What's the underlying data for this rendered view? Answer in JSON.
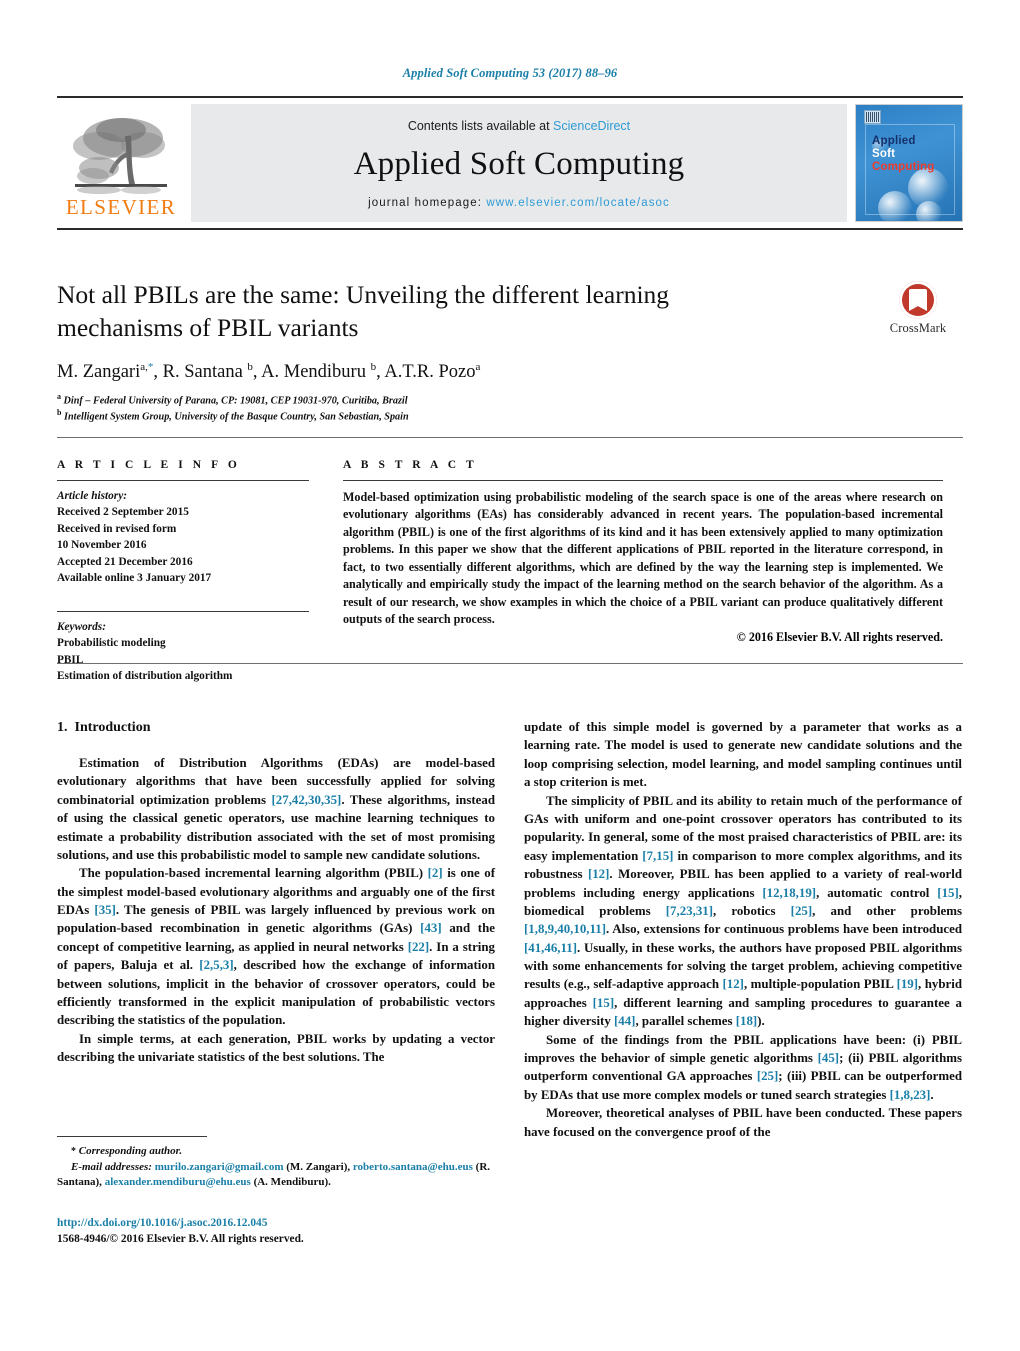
{
  "running_head": "Applied Soft Computing 53 (2017) 88–96",
  "masthead": {
    "publisher_name": "ELSEVIER",
    "contents_prefix": "Contents lists available at ",
    "contents_link": "ScienceDirect",
    "journal_title": "Applied Soft Computing",
    "homepage_prefix": "journal homepage: ",
    "homepage_url": "www.elsevier.com/locate/asoc",
    "cover": {
      "line1": "Applied",
      "line2": "Soft",
      "line3": "Computing",
      "color_applied": "#16306b",
      "color_soft": "#ffffff",
      "color_computing": "#ef3b2c",
      "background": "#2c7fc4"
    }
  },
  "article": {
    "title": "Not all PBILs are the same: Unveiling the different learning mechanisms of PBIL variants",
    "crossmark_label": "CrossMark",
    "authors": [
      {
        "name": "M. Zangari",
        "sup": "a,",
        "star": "*"
      },
      {
        "name": "R. Santana",
        "sup": "b"
      },
      {
        "name": "A. Mendiburu",
        "sup": "b"
      },
      {
        "name": "A.T.R. Pozo",
        "sup": "a"
      }
    ],
    "affiliations": [
      {
        "mark": "a",
        "text": "Dinf – Federal University of Parana, CP: 19081, CEP 19031-970, Curitiba, Brazil"
      },
      {
        "mark": "b",
        "text": "Intelligent System Group, University of the Basque Country, San Sebastian, Spain"
      }
    ]
  },
  "article_info": {
    "heading": "A R T I C L E  I N F O",
    "history_label": "Article history:",
    "history": [
      "Received 2 September 2015",
      "Received in revised form",
      "10 November 2016",
      "Accepted 21 December 2016",
      "Available online 3 January 2017"
    ],
    "keywords_label": "Keywords:",
    "keywords": [
      "Probabilistic modeling",
      "PBIL",
      "Estimation of distribution algorithm"
    ]
  },
  "abstract": {
    "heading": "A B S T R A C T",
    "text": "Model-based optimization using probabilistic modeling of the search space is one of the areas where research on evolutionary algorithms (EAs) has considerably advanced in recent years. The population-based incremental algorithm (PBIL) is one of the first algorithms of its kind and it has been extensively applied to many optimization problems. In this paper we show that the different applications of PBIL reported in the literature correspond, in fact, to two essentially different algorithms, which are defined by the way the learning step is implemented. We analytically and empirically study the impact of the learning method on the search behavior of the algorithm. As a result of our research, we show examples in which the choice of a PBIL variant can produce qualitatively different outputs of the search process.",
    "copyright": "© 2016 Elsevier B.V. All rights reserved."
  },
  "body": {
    "section_number": "1.",
    "section_title": "Introduction",
    "left_paragraphs": [
      "Estimation of Distribution Algorithms (EDAs) are model-based evolutionary algorithms that have been successfully applied for solving combinatorial optimization problems [27,42,30,35]. These algorithms, instead of using the classical genetic operators, use machine learning techniques to estimate a probability distribution associated with the set of most promising solutions, and use this probabilistic model to sample new candidate solutions.",
      "The population-based incremental learning algorithm (PBIL) [2] is one of the simplest model-based evolutionary algorithms and arguably one of the first EDAs [35]. The genesis of PBIL was largely influenced by previous work on population-based recombination in genetic algorithms (GAs) [43] and the concept of competitive learning, as applied in neural networks [22]. In a string of papers, Baluja et al. [2,5,3], described how the exchange of information between solutions, implicit in the behavior of crossover operators, could be efficiently transformed in the explicit manipulation of probabilistic vectors describing the statistics of the population.",
      "In simple terms, at each generation, PBIL works by updating a vector describing the univariate statistics of the best solutions. The"
    ],
    "right_paragraphs": [
      "update of this simple model is governed by a parameter that works as a learning rate. The model is used to generate new candidate solutions and the loop comprising selection, model learning, and model sampling continues until a stop criterion is met.",
      "The simplicity of PBIL and its ability to retain much of the performance of GAs with uniform and one-point crossover operators has contributed to its popularity. In general, some of the most praised characteristics of PBIL are: its easy implementation [7,15] in comparison to more complex algorithms, and its robustness [12]. Moreover, PBIL has been applied to a variety of real-world problems including energy applications [12,18,19], automatic control [15], biomedical problems [7,23,31], robotics [25], and other problems [1,8,9,40,10,11]. Also, extensions for continuous problems have been introduced [41,46,11]. Usually, in these works, the authors have proposed PBIL algorithms with some enhancements for solving the target problem, achieving competitive results (e.g., self-adaptive approach [12], multiple-population PBIL [19], hybrid approaches [15], different learning and sampling procedures to guarantee a higher diversity [44], parallel schemes [18]).",
      "Some of the findings from the PBIL applications have been: (i) PBIL improves the behavior of simple genetic algorithms [45]; (ii) PBIL algorithms outperform conventional GA approaches [25]; (iii) PBIL can be outperformed by EDAs that use more complex models or tuned search strategies [1,8,23].",
      "Moreover, theoretical analyses of PBIL have been conducted. These papers have focused on the convergence proof of the"
    ]
  },
  "footnotes": {
    "corresponding_star": "*",
    "corresponding_label": "Corresponding author.",
    "email_label": "E-mail addresses:",
    "emails": [
      {
        "address": "murilo.zangari@gmail.com",
        "owner": "(M. Zangari),"
      },
      {
        "address": "roberto.santana@ehu.eus",
        "owner": "(R. Santana),"
      },
      {
        "address": "alexander.mendiburu@ehu.eus",
        "owner": "(A. Mendiburu)."
      }
    ],
    "doi": "http://dx.doi.org/10.1016/j.asoc.2016.12.045",
    "issn_line": "1568-4946/© 2016 Elsevier B.V. All rights reserved."
  }
}
